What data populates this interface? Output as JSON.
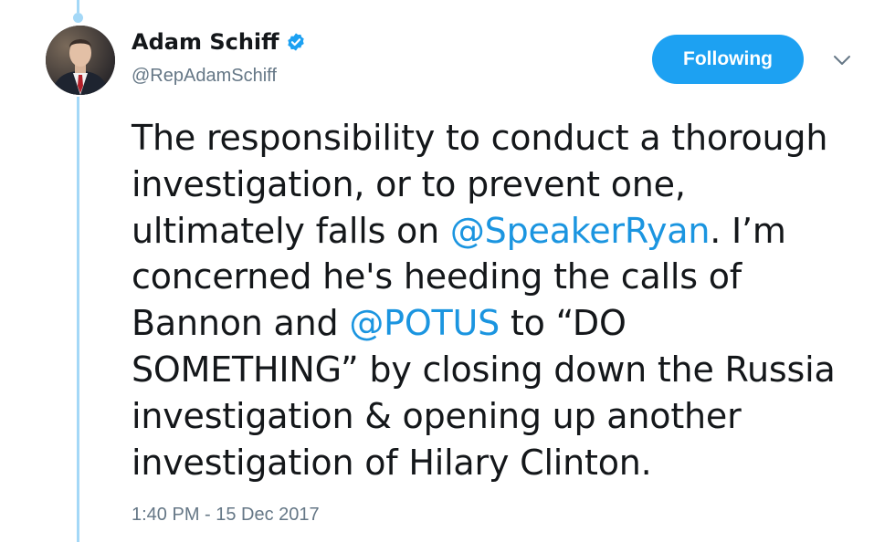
{
  "author": {
    "display_name": "Adam Schiff",
    "handle": "@RepAdamSchiff",
    "verified_icon": "verified-badge-icon",
    "avatar": "profile-photo"
  },
  "actions": {
    "follow_label": "Following",
    "caret_icon": "chevron-down-icon"
  },
  "tweet": {
    "segments": [
      {
        "text": "The responsibility to conduct a thorough",
        "type": "text"
      },
      {
        "text": "investigation, or to prevent one,",
        "type": "text"
      },
      {
        "text": "ultimately falls on ",
        "type": "text"
      },
      {
        "text": "@SpeakerRyan",
        "type": "mention"
      },
      {
        "text": ". I’m",
        "type": "text"
      },
      {
        "text": "concerned he's heeding the calls of",
        "type": "text"
      },
      {
        "text": "Bannon and ",
        "type": "text"
      },
      {
        "text": "@POTUS",
        "type": "mention"
      },
      {
        "text": " to “DO",
        "type": "text"
      },
      {
        "text": "SOMETHING” by closing down the Russia",
        "type": "text"
      },
      {
        "text": "investigation & opening up another",
        "type": "text"
      },
      {
        "text": "investigation of Hilary Clinton.",
        "type": "text"
      }
    ],
    "timestamp": "1:40 PM - 15 Dec 2017"
  },
  "colors": {
    "accent": "#1da1f2",
    "mention": "#1b95e0",
    "secondary_text": "#657786",
    "primary_text": "#14171a",
    "thread_line": "#a4d8f7"
  }
}
